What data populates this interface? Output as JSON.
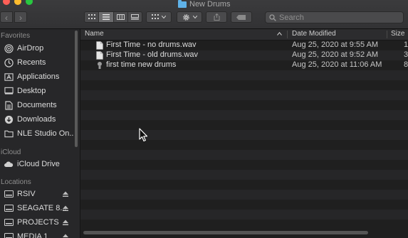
{
  "window": {
    "title": "New Drums"
  },
  "colors": {
    "close": "#fe5f57",
    "minimize": "#febc2e",
    "zoom": "#28c840",
    "accent": "#5fb2e8"
  },
  "toolbar": {
    "back_icon": "chevron-left-icon",
    "forward_icon": "chevron-right-icon",
    "view_modes": [
      "icon-view",
      "list-view",
      "column-view",
      "gallery-view"
    ],
    "active_view": "list-view",
    "search_placeholder": "Search"
  },
  "sidebar": {
    "favorites_title": "Favorites",
    "favorites": [
      {
        "label": "AirDrop",
        "icon": "airdrop-icon"
      },
      {
        "label": "Recents",
        "icon": "clock-icon"
      },
      {
        "label": "Applications",
        "icon": "applications-icon"
      },
      {
        "label": "Desktop",
        "icon": "desktop-icon"
      },
      {
        "label": "Documents",
        "icon": "document-icon"
      },
      {
        "label": "Downloads",
        "icon": "download-icon"
      },
      {
        "label": "NLE Studio On...",
        "icon": "folder-icon"
      }
    ],
    "icloud_title": "iCloud",
    "icloud": [
      {
        "label": "iCloud Drive",
        "icon": "cloud-icon"
      }
    ],
    "locations_title": "Locations",
    "locations": [
      {
        "label": "RSIV",
        "icon": "drive-icon"
      },
      {
        "label": "SEAGATE 8...",
        "icon": "drive-icon"
      },
      {
        "label": "PROJECTS",
        "icon": "drive-icon"
      },
      {
        "label": "MEDIA 1",
        "icon": "drive-icon"
      }
    ]
  },
  "columns": {
    "name": "Name",
    "date": "Date Modified",
    "size": "Size"
  },
  "files": [
    {
      "name": "First Time - no drums.wav",
      "date": "Aug 25, 2020 at 9:55 AM",
      "size": "1",
      "icon": "audio-file-icon"
    },
    {
      "name": "First Time - old drums.wav",
      "date": "Aug 25, 2020 at 9:52 AM",
      "size": "3",
      "icon": "audio-file-icon"
    },
    {
      "name": "first time new drums",
      "date": "Aug 25, 2020 at 11:06 AM",
      "size": "8",
      "icon": "project-file-icon"
    }
  ]
}
